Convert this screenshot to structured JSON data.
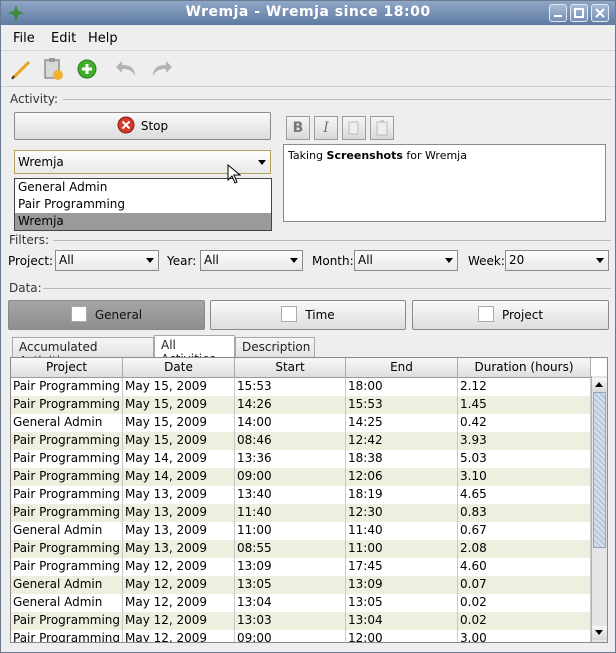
{
  "window": {
    "title": "Wremja - Wremja since 18:00"
  },
  "menu": [
    "File",
    "Edit",
    "Help"
  ],
  "toolbar": {
    "icons": [
      "pencil-icon",
      "paste-icon",
      "add-icon",
      "undo-icon",
      "redo-icon"
    ]
  },
  "activity": {
    "label": "Activity:",
    "stop_label": "Stop",
    "project_selected": "Wremja",
    "project_options": [
      "General Admin",
      "Pair Programming",
      "Wremja"
    ],
    "description_text_prefix": "Taking ",
    "description_text_bold": "Screenshots",
    "description_text_suffix": " for Wremja",
    "format_buttons": [
      "B",
      "I"
    ]
  },
  "filters": {
    "label": "Filters:",
    "project_label": "Project:",
    "project_value": "All",
    "year_label": "Year:",
    "year_value": "All",
    "month_label": "Month:",
    "month_value": "All",
    "week_label": "Week:",
    "week_value": "20"
  },
  "data": {
    "label": "Data:",
    "view_tabs": [
      "General",
      "Time",
      "Project"
    ],
    "sub_tabs": [
      "Accumulated Activities",
      "All Activities",
      "Description"
    ],
    "columns": [
      "Project",
      "Date",
      "Start",
      "End",
      "Duration (hours)"
    ],
    "rows": [
      [
        "Pair Programming",
        "May 15, 2009",
        "15:53",
        "18:00",
        "2.12"
      ],
      [
        "Pair Programming",
        "May 15, 2009",
        "14:26",
        "15:53",
        "1.45"
      ],
      [
        "General Admin",
        "May 15, 2009",
        "14:00",
        "14:25",
        "0.42"
      ],
      [
        "Pair Programming",
        "May 15, 2009",
        "08:46",
        "12:42",
        "3.93"
      ],
      [
        "Pair Programming",
        "May 14, 2009",
        "13:36",
        "18:38",
        "5.03"
      ],
      [
        "Pair Programming",
        "May 14, 2009",
        "09:00",
        "12:06",
        "3.10"
      ],
      [
        "Pair Programming",
        "May 13, 2009",
        "13:40",
        "18:19",
        "4.65"
      ],
      [
        "Pair Programming",
        "May 13, 2009",
        "11:40",
        "12:30",
        "0.83"
      ],
      [
        "General Admin",
        "May 13, 2009",
        "11:00",
        "11:40",
        "0.67"
      ],
      [
        "Pair Programming",
        "May 13, 2009",
        "08:55",
        "11:00",
        "2.08"
      ],
      [
        "Pair Programming",
        "May 12, 2009",
        "13:09",
        "17:45",
        "4.60"
      ],
      [
        "General Admin",
        "May 12, 2009",
        "13:05",
        "13:09",
        "0.07"
      ],
      [
        "General Admin",
        "May 12, 2009",
        "13:04",
        "13:05",
        "0.02"
      ],
      [
        "Pair Programming",
        "May 12, 2009",
        "13:03",
        "13:04",
        "0.02"
      ],
      [
        "Pair Programming",
        "May 12, 2009",
        "09:00",
        "12:00",
        "3.00"
      ]
    ]
  },
  "colors": {
    "titlebar": "#6f89b0",
    "row_alt": "#efefdf",
    "stop_icon": "#d23a2a",
    "add_icon": "#3fae2a"
  }
}
